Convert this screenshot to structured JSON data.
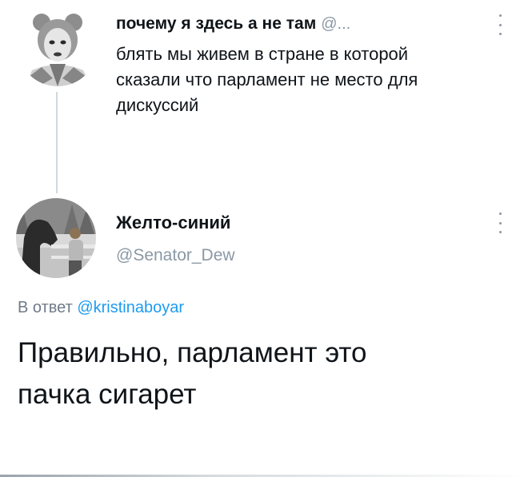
{
  "tweet1": {
    "author_name": "почему я здесь а не там",
    "author_handle": "@...",
    "text_lines": [
      "блять мы живем в стране в которой",
      "сказали что парламент не место для",
      "дискуссий"
    ]
  },
  "tweet2": {
    "author_name": "Желто-синий",
    "author_handle": "@Senator_Dew",
    "reply_prefix": "В ответ",
    "reply_mention": "@kristinaboyar",
    "text_lines": [
      "Правильно, парламент это",
      "пачка сигарет"
    ]
  },
  "colors": {
    "text": "#0f1419",
    "secondary": "#8b98a5",
    "link": "#1d9bf0",
    "thread_line": "#cfd9de"
  }
}
